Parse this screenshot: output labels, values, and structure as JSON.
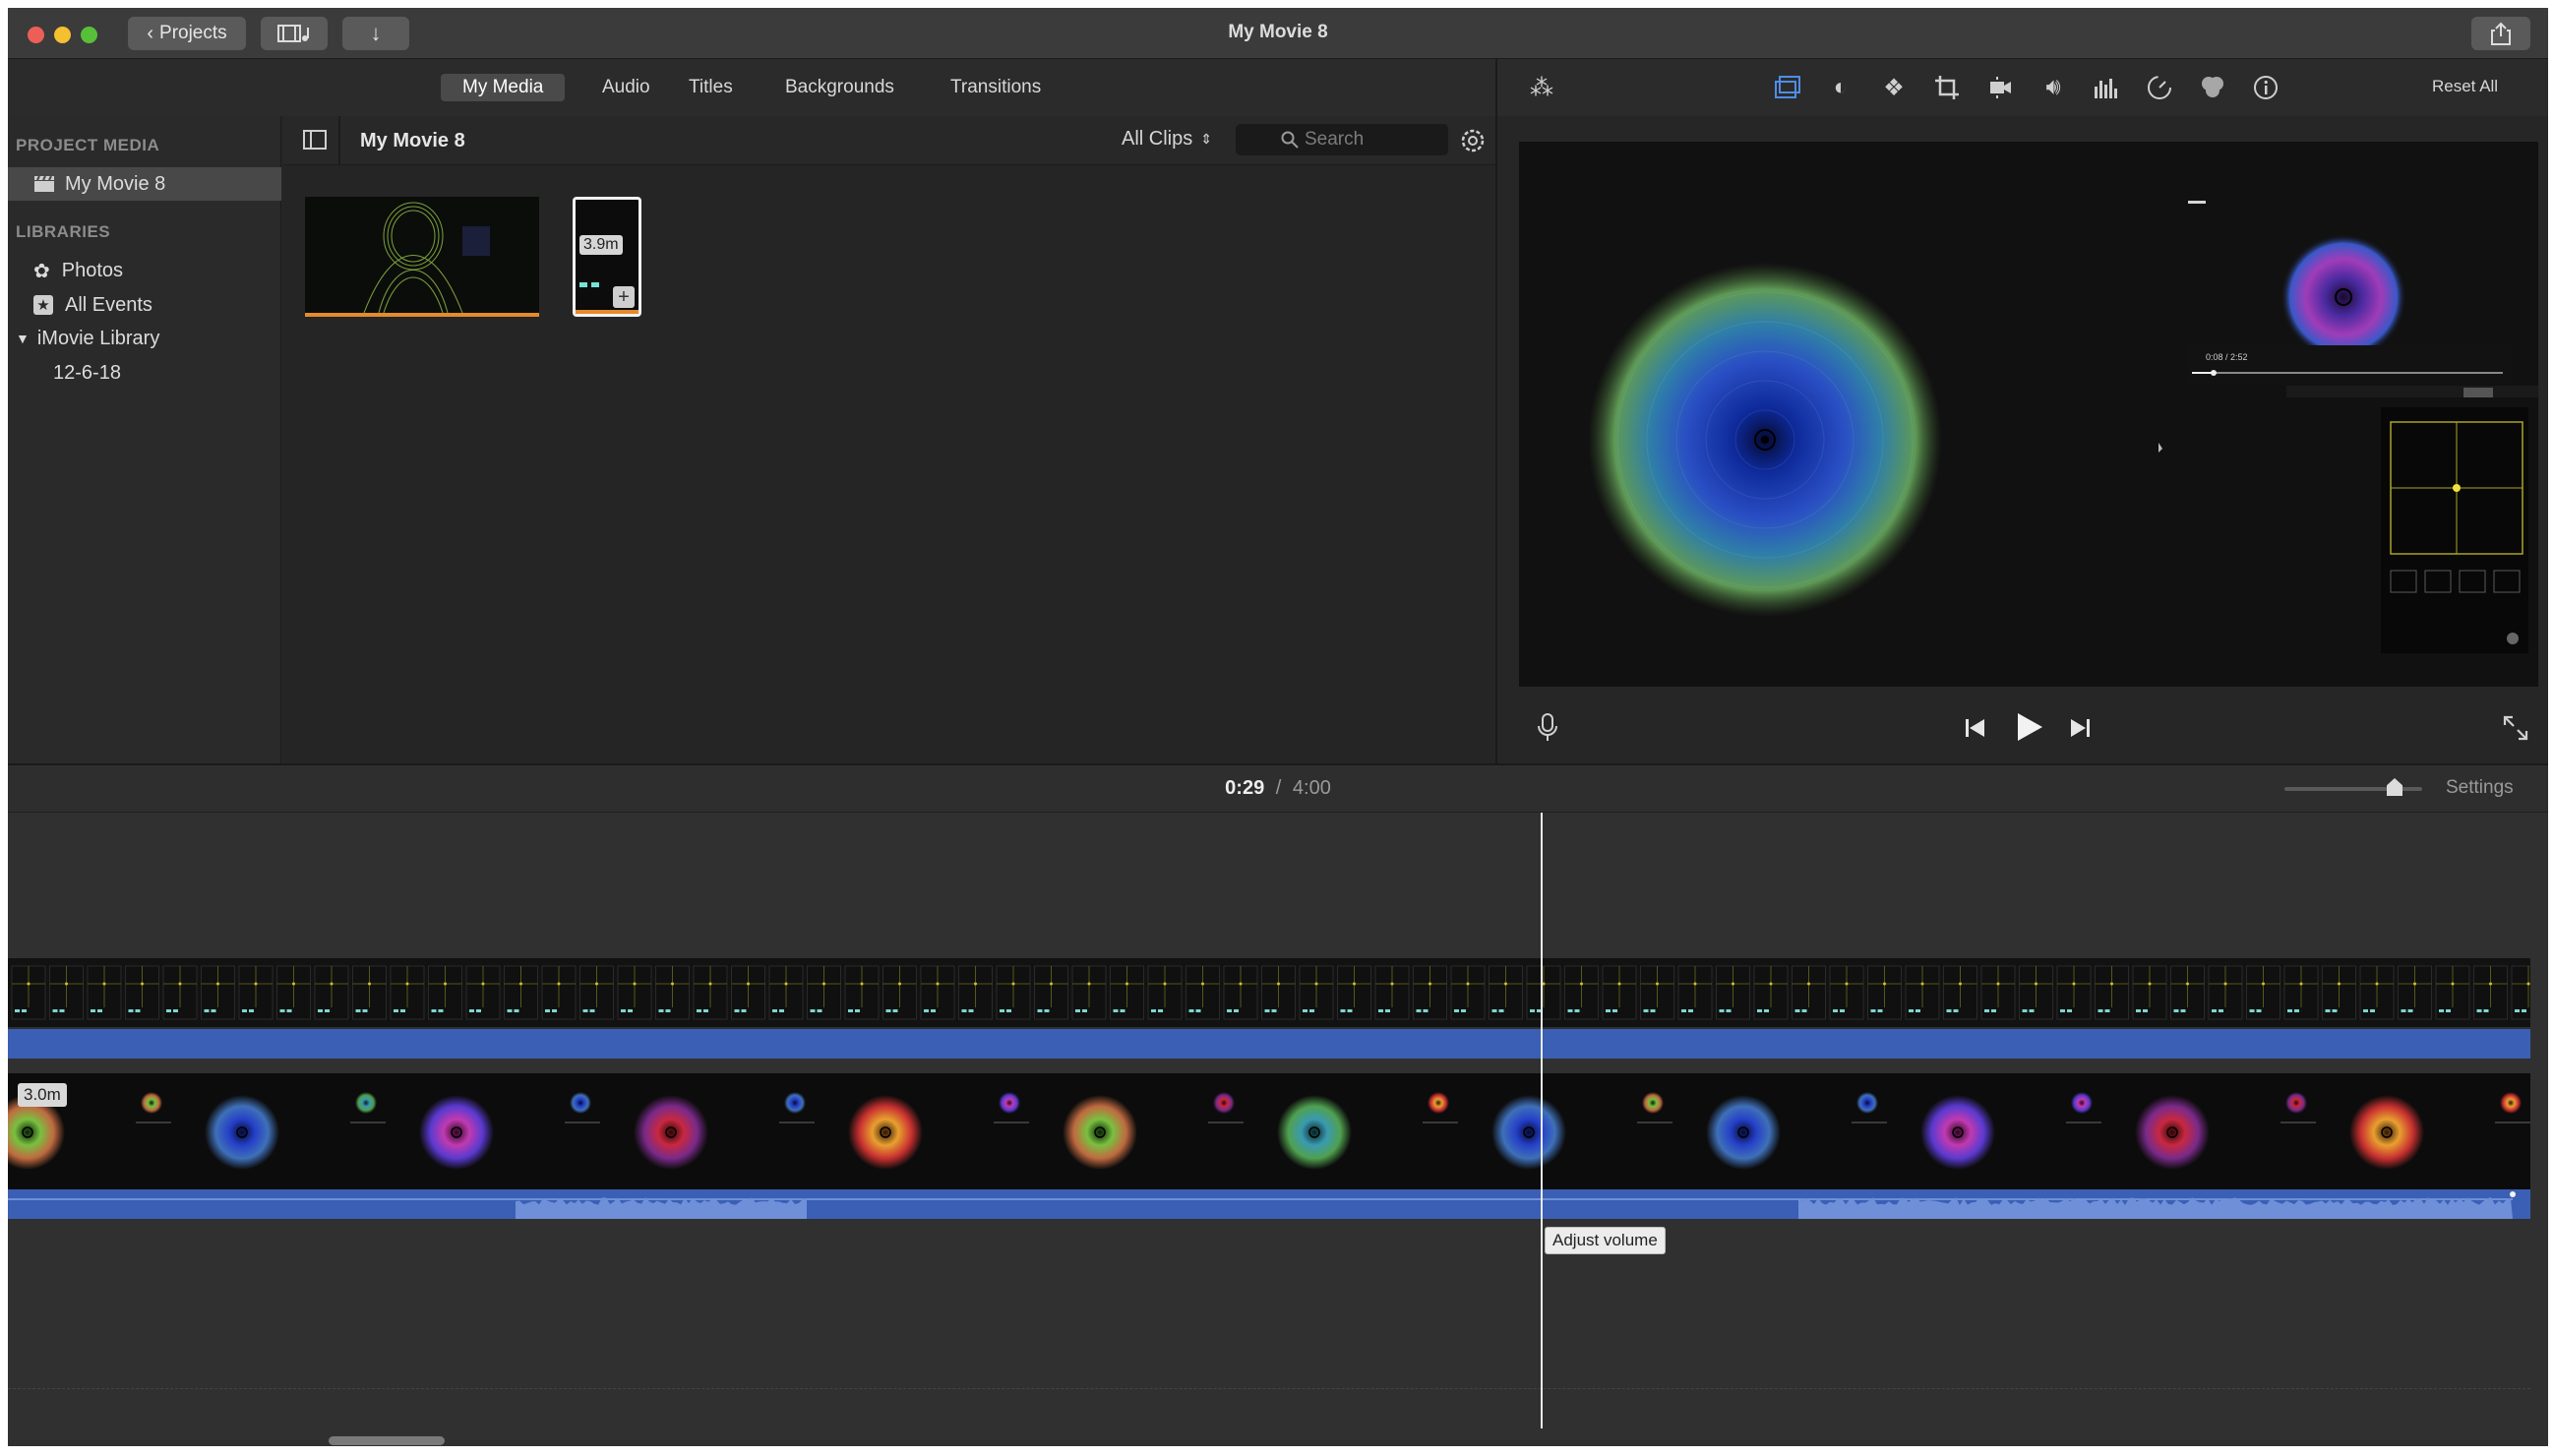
{
  "window": {
    "title": "My Movie 8"
  },
  "toolbar": {
    "projects_label": "Projects"
  },
  "browser_tabs": [
    "My Media",
    "Audio",
    "Titles",
    "Backgrounds",
    "Transitions"
  ],
  "sidebar": {
    "project_media_heading": "PROJECT MEDIA",
    "project_item": "My Movie 8",
    "libraries_heading": "LIBRARIES",
    "photos": "Photos",
    "all_events": "All Events",
    "library": "iMovie Library",
    "event": "12-6-18"
  },
  "media": {
    "title": "My Movie 8",
    "filter": "All Clips",
    "search_placeholder": "Search",
    "clip_badge": "3.9m"
  },
  "viewer": {
    "reset_all": "Reset All",
    "mini_time": "0:08 / 2:52"
  },
  "timeline": {
    "current_time": "0:29",
    "separator": "/",
    "total_time": "4:00",
    "settings": "Settings",
    "clip_badge": "3.0m",
    "tooltip": "Adjust volume",
    "zoom_fraction": 0.8
  },
  "icons": [
    "close-icon",
    "minimize-icon",
    "zoom-icon",
    "chevron-left-icon",
    "film-music-icon",
    "import-arrow-icon",
    "share-icon",
    "sidebar-toggle-icon",
    "clapper-icon",
    "photos-icon",
    "star-icon",
    "disclosure-triangle-icon",
    "search-icon",
    "gear-icon",
    "magic-wand-icon",
    "crop-to-fill-icon",
    "color-balance-icon",
    "color-palette-icon",
    "crop-icon",
    "stabilization-icon",
    "volume-icon",
    "equalizer-icon",
    "speed-icon",
    "filter-icon",
    "info-icon",
    "microphone-icon",
    "skip-back-icon",
    "play-icon",
    "skip-forward-icon",
    "fullscreen-icon"
  ],
  "colors": {
    "accent_blue": "#3a5fb4",
    "clip_orange": "#e58a2e",
    "playhead": "#e8e8e8"
  }
}
